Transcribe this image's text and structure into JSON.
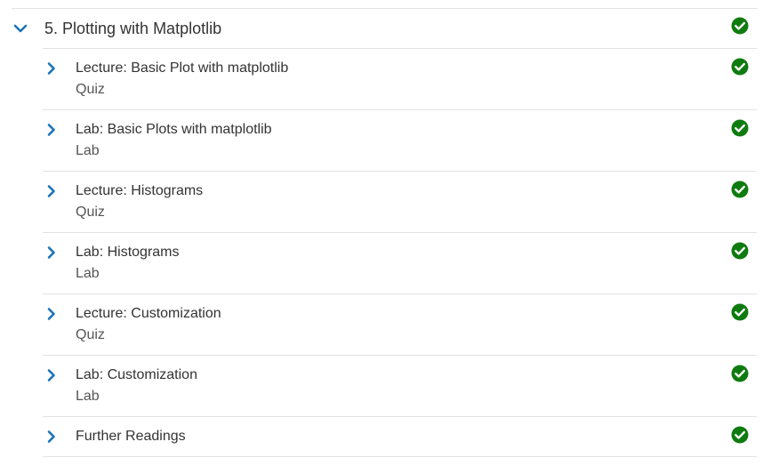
{
  "section": {
    "title": "5. Plotting with Matplotlib",
    "expanded": true,
    "completed": true,
    "icon": "chevron-down-icon"
  },
  "items": [
    {
      "title": "Lecture: Basic Plot with matplotlib",
      "type": "Quiz",
      "completed": true
    },
    {
      "title": "Lab: Basic Plots with matplotlib",
      "type": "Lab",
      "completed": true
    },
    {
      "title": "Lecture: Histograms",
      "type": "Quiz",
      "completed": true
    },
    {
      "title": "Lab: Histograms",
      "type": "Lab",
      "completed": true
    },
    {
      "title": "Lecture: Customization",
      "type": "Quiz",
      "completed": true
    },
    {
      "title": "Lab: Customization",
      "type": "Lab",
      "completed": true
    },
    {
      "title": "Further Readings",
      "type": "",
      "completed": true
    }
  ],
  "colors": {
    "chevron": "#1a73b8",
    "check": "#0f7b0f",
    "divider": "#e2e2e2"
  },
  "icons": {
    "item_expand": "chevron-right-icon",
    "completed": "check-circle-icon"
  }
}
